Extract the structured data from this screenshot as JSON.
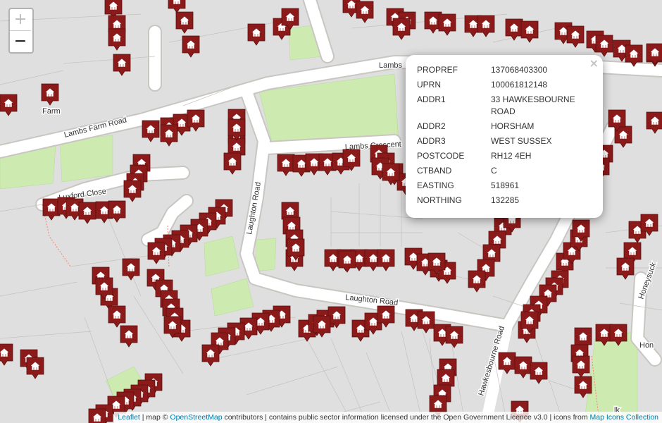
{
  "zoom": {
    "in_label": "+",
    "out_label": "−"
  },
  "streets": [
    {
      "id": "lambs-farm-road",
      "label": "Lambs Farm Road"
    },
    {
      "id": "lambs-farm-road-2",
      "label": "Lambs"
    },
    {
      "id": "lambs-crescent",
      "label": "Lambs Crescent"
    },
    {
      "id": "luxford-close",
      "label": "Luxford Close"
    },
    {
      "id": "laughton-road-v",
      "label": "Laughton Road"
    },
    {
      "id": "laughton-road-h",
      "label": "Laughton Road"
    },
    {
      "id": "hawkesbourne-road",
      "label": "Hawkesbourne Road"
    },
    {
      "id": "honeysuckle",
      "label": "Honeysuck"
    },
    {
      "id": "hon",
      "label": "Hon"
    },
    {
      "id": "farm",
      "label": "Farm"
    },
    {
      "id": "lk",
      "label": "lk"
    }
  ],
  "markers": {
    "color": "#8b1a1a",
    "icon": "house-icon",
    "count": 210
  },
  "popup": {
    "close_label": "×",
    "rows": [
      {
        "key": "PROPREF",
        "value": "137068403300"
      },
      {
        "key": "UPRN",
        "value": "100061812148"
      },
      {
        "key": "ADDR1",
        "value": "33 HAWKESBOURNE ROAD"
      },
      {
        "key": "ADDR2",
        "value": "HORSHAM"
      },
      {
        "key": "ADDR3",
        "value": "WEST SUSSEX"
      },
      {
        "key": "POSTCODE",
        "value": "RH12 4EH"
      },
      {
        "key": "CTBAND",
        "value": "C"
      },
      {
        "key": "EASTING",
        "value": "518961"
      },
      {
        "key": "NORTHING",
        "value": "132285"
      }
    ]
  },
  "attribution": {
    "leaflet": "Leaflet",
    "sep1": " | map © ",
    "osm": "OpenStreetMap",
    "text": " contributors | contains public sector information licensed under the Open Government Licence v3.0 | icons from ",
    "icons": "Map Icons Collection"
  }
}
